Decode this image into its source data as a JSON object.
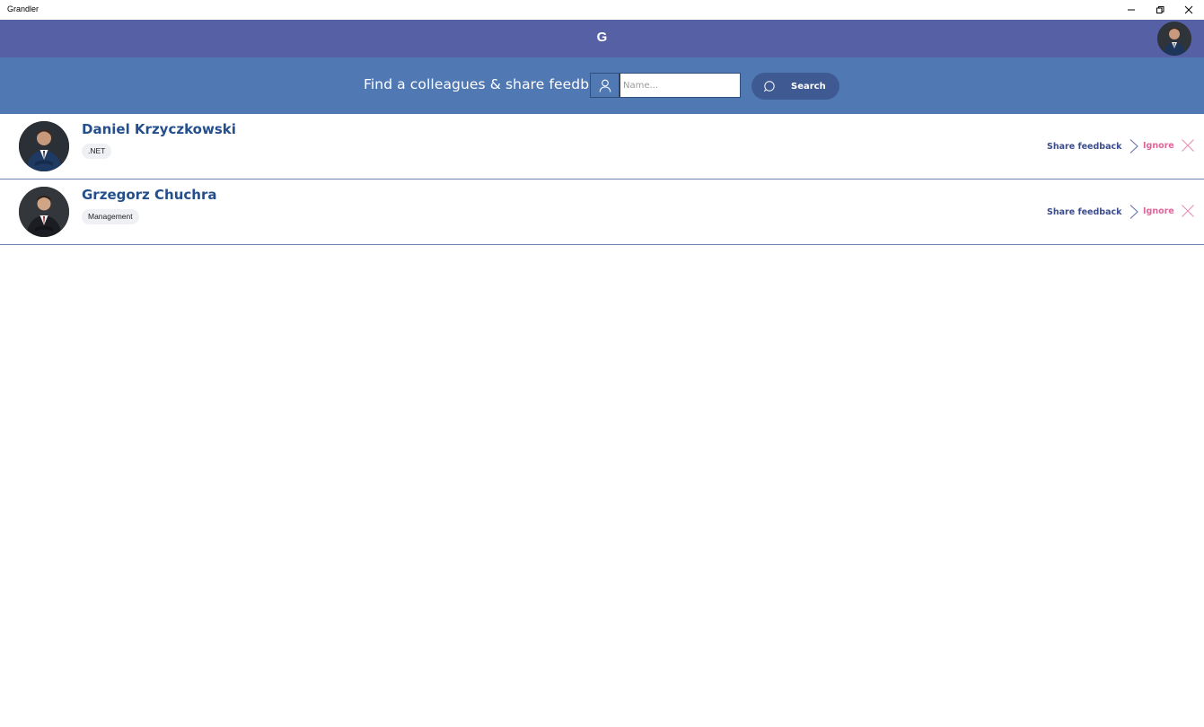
{
  "window": {
    "title": "Grandler",
    "controls": [
      "minimize-icon",
      "restore-icon",
      "close-icon"
    ]
  },
  "header": {
    "logo": "G"
  },
  "search": {
    "label": "Find a colleagues & share feedback",
    "placeholder": "Name...",
    "value": "",
    "button_label": "Search"
  },
  "colleagues": [
    {
      "name": "Daniel Krzyczkowski",
      "tag": ".NET",
      "share_label": "Share feedback",
      "ignore_label": "Ignore"
    },
    {
      "name": "Grzegorz Chuchra",
      "tag": "Management",
      "share_label": "Share feedback",
      "ignore_label": "Ignore"
    }
  ],
  "colors": {
    "appbar": "#5560a5",
    "searchband": "#5079b4",
    "name": "#244f8c",
    "share": "#3c4d8c",
    "ignore": "#e0669a"
  }
}
